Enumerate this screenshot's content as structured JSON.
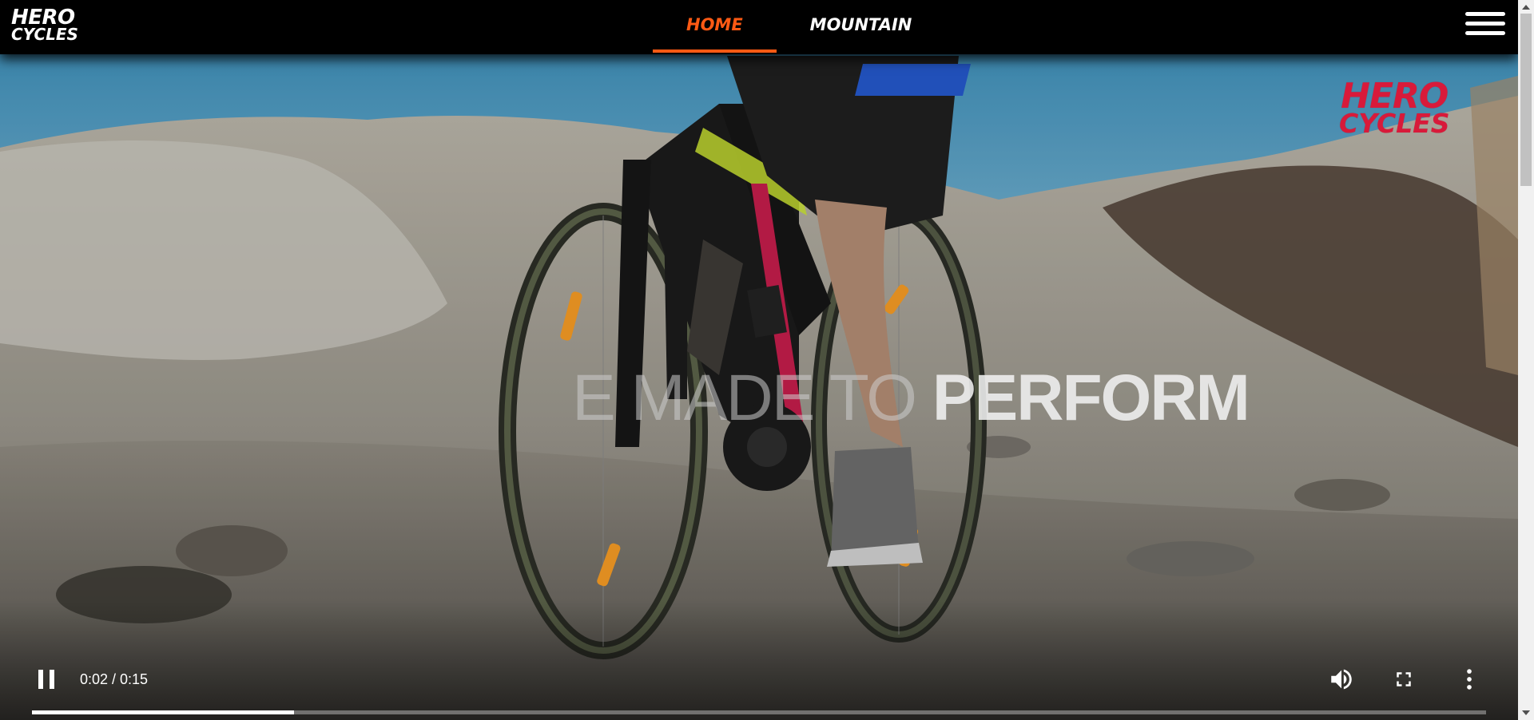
{
  "header": {
    "logo_line1": "HERO",
    "logo_line2": "CYCLES",
    "nav": [
      {
        "label": "HOME",
        "active": true
      },
      {
        "label": "MOUNTAIN",
        "active": false
      }
    ],
    "menu_icon": "hamburger-icon"
  },
  "video": {
    "watermark_line1": "HERO",
    "watermark_line2": "CYCLES",
    "tagline_part1": "E MADE TO ",
    "tagline_part2": "PERFORM",
    "time_display": "0:02 / 0:15",
    "progress_fraction": 0.18,
    "controls": {
      "play_pause_icon": "pause-icon",
      "volume_icon": "volume-icon",
      "fullscreen_icon": "fullscreen-icon",
      "more_icon": "more-vertical-icon"
    }
  },
  "colors": {
    "accent": "#ff5a14",
    "brand_red": "#d81a3a",
    "header_bg": "#000000"
  }
}
